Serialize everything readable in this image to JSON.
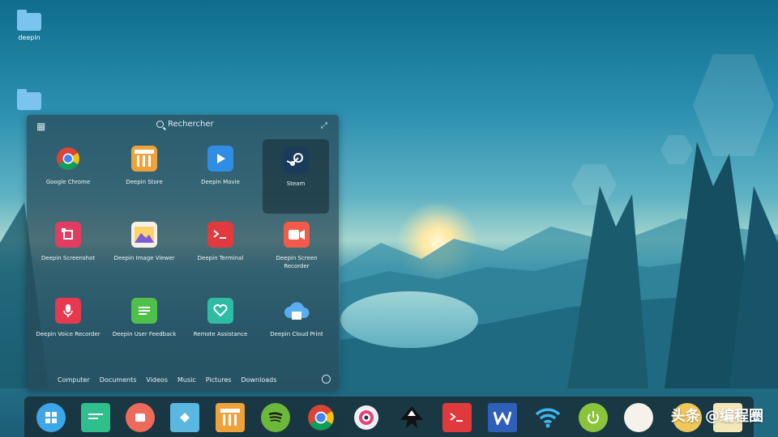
{
  "desktop": {
    "icons": [
      {
        "label": "deepin"
      },
      {
        "label": ""
      }
    ]
  },
  "launcher": {
    "search_placeholder": "Rechercher",
    "apps": [
      {
        "name": "Google Chrome",
        "icon": "chrome-icon"
      },
      {
        "name": "Deepin Store",
        "icon": "store-icon"
      },
      {
        "name": "Deepin Movie",
        "icon": "movie-icon"
      },
      {
        "name": "Steam",
        "icon": "steam-icon",
        "selected": true
      },
      {
        "name": "Deepin Screenshot",
        "icon": "screenshot-icon"
      },
      {
        "name": "Deepin Image Viewer",
        "icon": "image-viewer-icon"
      },
      {
        "name": "Deepin Terminal",
        "icon": "terminal-icon"
      },
      {
        "name": "Deepin Screen Recorder",
        "icon": "screen-recorder-icon"
      },
      {
        "name": "Deepin Voice Recorder",
        "icon": "voice-recorder-icon"
      },
      {
        "name": "Deepin User Feedback",
        "icon": "feedback-icon"
      },
      {
        "name": "Remote Assistance",
        "icon": "remote-assistance-icon"
      },
      {
        "name": "Deepin Cloud Print",
        "icon": "cloud-print-icon"
      }
    ],
    "categories": [
      "Computer",
      "Documents",
      "Videos",
      "Music",
      "Pictures",
      "Downloads"
    ]
  },
  "dock": {
    "items": [
      "launcher-icon",
      "deepin-app-icon",
      "screen-recorder-icon",
      "store-icon",
      "store-alt-icon",
      "spotify-icon",
      "chrome-icon",
      "settings-flower-icon",
      "inkscape-icon",
      "terminal-icon",
      "wps-writer-icon",
      "wifi-icon",
      "power-icon"
    ]
  },
  "watermark": "头条 @编程圈"
}
